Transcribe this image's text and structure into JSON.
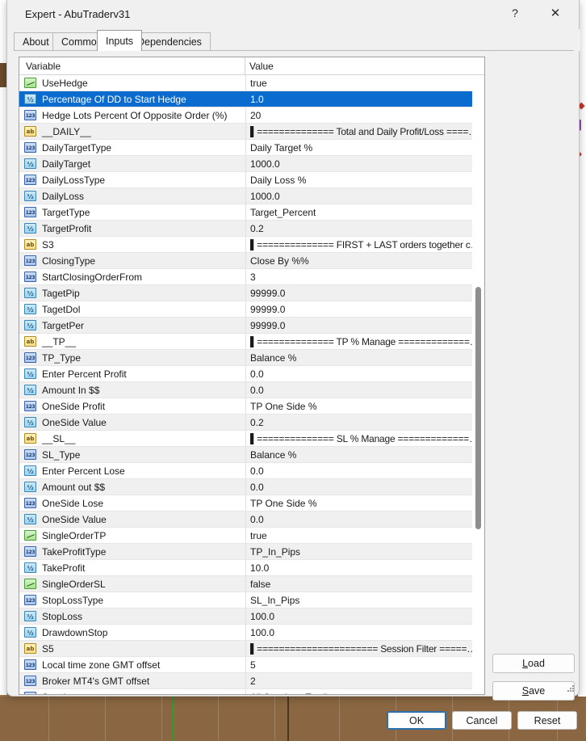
{
  "window": {
    "title": "Expert - AbuTraderv31",
    "help_icon": "?",
    "close_icon": "✕"
  },
  "tabs": [
    {
      "label": "About",
      "active": false
    },
    {
      "label": "Common",
      "active": false
    },
    {
      "label": "Inputs",
      "active": true
    },
    {
      "label": "Dependencies",
      "active": false
    }
  ],
  "grid": {
    "columns": {
      "variable": "Variable",
      "value": "Value"
    },
    "selected_index": 1,
    "rows": [
      {
        "type": "bool",
        "variable": "UseHedge",
        "value": "true"
      },
      {
        "type": "dbl",
        "variable": "Percentage Of DD to Start Hedge",
        "value": "1.0"
      },
      {
        "type": "int",
        "variable": "Hedge Lots Percent Of Opposite Order (%)",
        "value": "20"
      },
      {
        "type": "str",
        "variable": "__DAILY__",
        "value": "▌============== Total and Daily Profit/Loss ======...",
        "separator": true
      },
      {
        "type": "int",
        "variable": "DailyTargetType",
        "value": "Daily Target %"
      },
      {
        "type": "dbl",
        "variable": "DailyTarget",
        "value": "1000.0"
      },
      {
        "type": "int",
        "variable": "DailyLossType",
        "value": "Daily Loss %"
      },
      {
        "type": "dbl",
        "variable": "DailyLoss",
        "value": "1000.0"
      },
      {
        "type": "int",
        "variable": "TargetType",
        "value": "Target_Percent"
      },
      {
        "type": "dbl",
        "variable": "TargetProfit",
        "value": "0.2"
      },
      {
        "type": "str",
        "variable": "S3",
        "value": "▌============== FIRST + LAST orders together clos...",
        "separator": true
      },
      {
        "type": "int",
        "variable": "ClosingType",
        "value": "Close By %%"
      },
      {
        "type": "int",
        "variable": "StartClosingOrderFrom",
        "value": "3"
      },
      {
        "type": "dbl",
        "variable": "TagetPip",
        "value": "99999.0"
      },
      {
        "type": "dbl",
        "variable": "TagetDol",
        "value": "99999.0"
      },
      {
        "type": "dbl",
        "variable": "TargetPer",
        "value": "99999.0"
      },
      {
        "type": "str",
        "variable": "__TP__",
        "value": "▌============== TP % Manage ==============▌",
        "separator": true
      },
      {
        "type": "int",
        "variable": "TP_Type",
        "value": "Balance %"
      },
      {
        "type": "dbl",
        "variable": "Enter Percent Profit",
        "value": "0.0"
      },
      {
        "type": "dbl",
        "variable": "Amount In $$",
        "value": "0.0"
      },
      {
        "type": "int",
        "variable": "OneSide Profit",
        "value": "TP One Side %"
      },
      {
        "type": "dbl",
        "variable": "OneSide Value",
        "value": "0.2"
      },
      {
        "type": "str",
        "variable": "__SL__",
        "value": "▌============== SL % Manage ==============▌",
        "separator": true
      },
      {
        "type": "int",
        "variable": "SL_Type",
        "value": "Balance %"
      },
      {
        "type": "dbl",
        "variable": "Enter Percent Lose",
        "value": "0.0"
      },
      {
        "type": "dbl",
        "variable": "Amount out $$",
        "value": "0.0"
      },
      {
        "type": "int",
        "variable": "OneSide Lose",
        "value": "TP One Side %"
      },
      {
        "type": "dbl",
        "variable": "OneSide Value",
        "value": "0.0"
      },
      {
        "type": "bool",
        "variable": "SingleOrderTP",
        "value": "true"
      },
      {
        "type": "int",
        "variable": "TakeProfitType",
        "value": "TP_In_Pips"
      },
      {
        "type": "dbl",
        "variable": "TakeProfit",
        "value": "10.0"
      },
      {
        "type": "bool",
        "variable": "SingleOrderSL",
        "value": "false"
      },
      {
        "type": "int",
        "variable": "StopLossType",
        "value": "SL_In_Pips"
      },
      {
        "type": "dbl",
        "variable": "StopLoss",
        "value": "100.0"
      },
      {
        "type": "dbl",
        "variable": "DrawdownStop",
        "value": "100.0"
      },
      {
        "type": "str",
        "variable": "S5",
        "value": "▌====================== Session Filter ========...",
        "separator": true
      },
      {
        "type": "int",
        "variable": "Local time zone GMT offset",
        "value": "5"
      },
      {
        "type": "int",
        "variable": "Broker MT4's GMT offset",
        "value": "2"
      },
      {
        "type": "int",
        "variable": "Session",
        "value": "All Sessions Trading",
        "clipped": true
      }
    ]
  },
  "buttons": {
    "load": "Load",
    "load_mnemonic": "L",
    "save": "Save",
    "save_mnemonic": "S",
    "ok": "OK",
    "cancel": "Cancel",
    "reset": "Reset"
  },
  "colors": {
    "selection": "#0a6ccf",
    "dialog_bg": "#f0f0f0",
    "grid_bg": "#ffffff",
    "alt_row": "#f0f0f0",
    "default_button_border": "#2b6fae",
    "desktop": "#8a6742"
  }
}
